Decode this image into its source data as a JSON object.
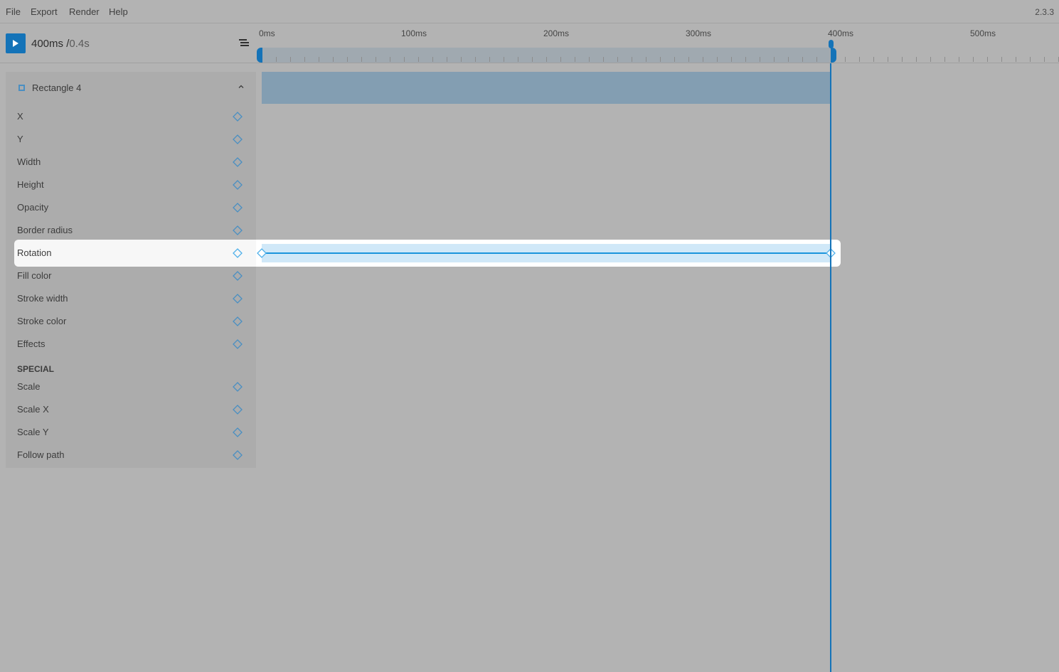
{
  "menu": {
    "items": [
      "File",
      "Export",
      "Render",
      "Help"
    ],
    "version": "2.3.3"
  },
  "toolbar": {
    "play_icon": "play-icon",
    "current_time": "400ms /",
    "total_time": "0.4s",
    "list_icon": "list-icon"
  },
  "timeline": {
    "ruler_labels": [
      "0ms",
      "100ms",
      "200ms",
      "300ms",
      "400ms",
      "500ms"
    ],
    "ruler_values_ms": [
      0,
      100,
      200,
      300,
      400,
      500
    ],
    "tick_interval_ms": 10,
    "range_start_ms": 0,
    "range_end_ms": 400,
    "playhead_ms": 400,
    "accent_color": "#1473b8"
  },
  "layer": {
    "name": "Rectangle 4",
    "icon": "rectangle-icon",
    "track_start_ms": 0,
    "track_end_ms": 400
  },
  "properties": [
    {
      "label": "X"
    },
    {
      "label": "Y"
    },
    {
      "label": "Width"
    },
    {
      "label": "Height"
    },
    {
      "label": "Opacity"
    },
    {
      "label": "Border radius"
    },
    {
      "label": "Rotation",
      "active": true,
      "keyframes_ms": [
        0,
        400
      ]
    },
    {
      "label": "Fill color"
    },
    {
      "label": "Stroke width"
    },
    {
      "label": "Stroke color"
    },
    {
      "label": "Effects"
    }
  ],
  "special": {
    "title": "SPECIAL",
    "properties": [
      {
        "label": "Scale"
      },
      {
        "label": "Scale X"
      },
      {
        "label": "Scale Y"
      },
      {
        "label": "Follow path"
      }
    ]
  }
}
